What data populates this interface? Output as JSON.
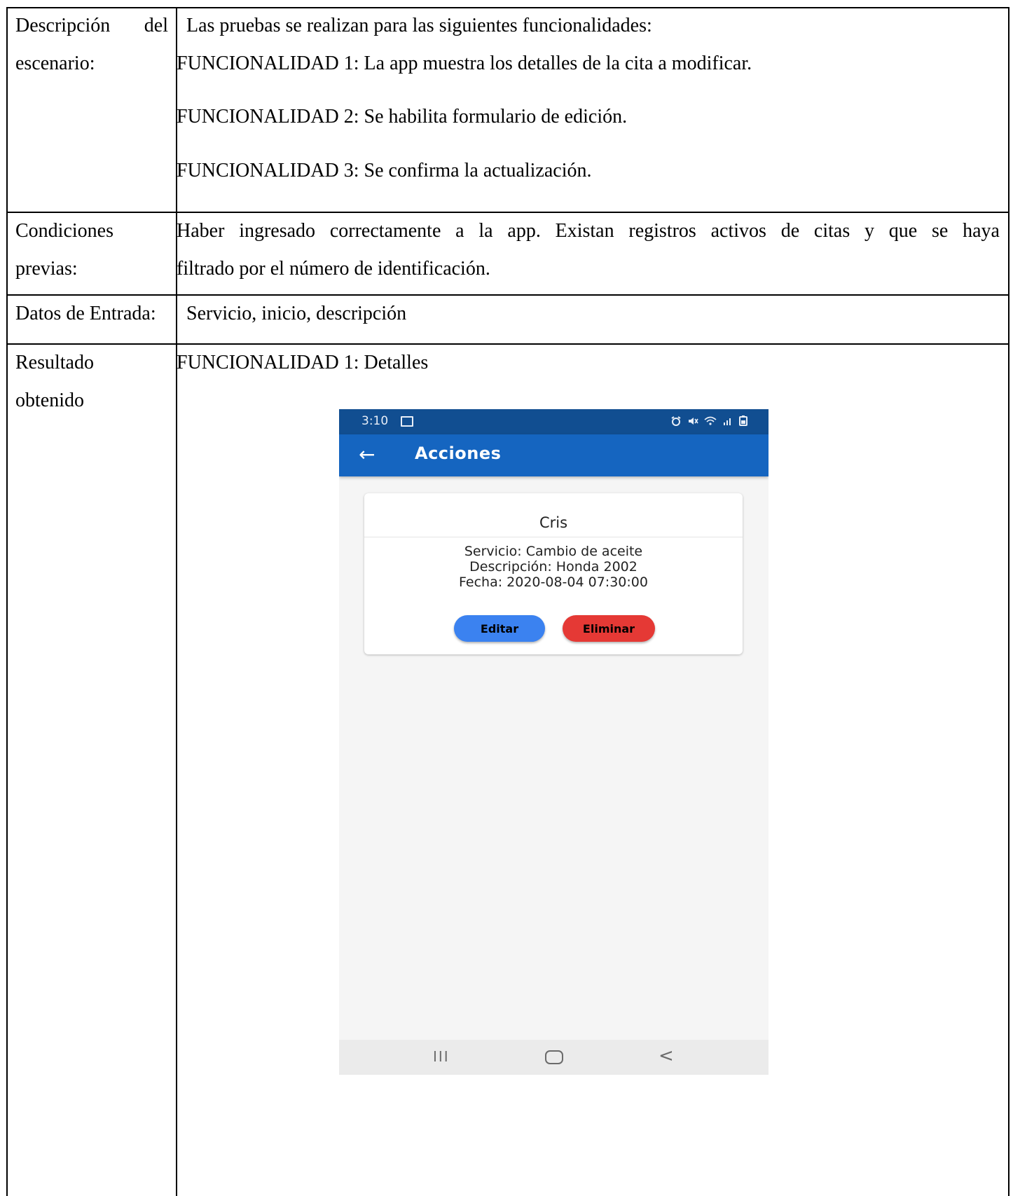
{
  "rows": {
    "descripcion": {
      "label_line1_left": "Descripción",
      "label_line1_right": "del",
      "label_line2": "escenario:",
      "intro": "Las pruebas se realizan para las siguientes funcionalidades:",
      "items": [
        "FUNCIONALIDAD 1: La app muestra los detalles de la cita a modificar.",
        "FUNCIONALIDAD 2: Se habilita formulario de edición.",
        "FUNCIONALIDAD 3: Se confirma la actualización."
      ]
    },
    "condiciones": {
      "label_line1": "Condiciones",
      "label_line2": "previas:",
      "line1_words": [
        "Haber",
        "ingresado",
        "correctamente",
        "a",
        "la",
        "app.",
        "Existan",
        "registros",
        "activos",
        "de",
        "citas",
        "y",
        "que",
        "se",
        "haya"
      ],
      "line2": "filtrado por el número de identificación."
    },
    "datos": {
      "label": "Datos de Entrada:",
      "value": "Servicio, inicio, descripción"
    },
    "resultado": {
      "label_line1": "Resultado",
      "label_line2": "obtenido",
      "heading": "FUNCIONALIDAD 1: Detalles"
    }
  },
  "phone": {
    "status_time": "3:10",
    "status_icons": [
      "image-icon",
      "alarm-icon",
      "mute-icon",
      "wifi-icon",
      "signal-icon",
      "battery-icon"
    ],
    "appbar_title": "Acciones",
    "back_icon": "←",
    "card": {
      "name": "Cris",
      "servicio": "Servicio: Cambio de aceite",
      "descripcion": "Descripción:  Honda 2002",
      "fecha": "Fecha: 2020-08-04 07:30:00",
      "edit_label": "Editar",
      "delete_label": "Eliminar"
    },
    "nav": {
      "recent": "III",
      "back": "<"
    },
    "colors": {
      "status_bar": "#114e91",
      "app_bar": "#1565c0",
      "edit_button": "#3b82f0",
      "delete_button": "#e53935"
    }
  }
}
